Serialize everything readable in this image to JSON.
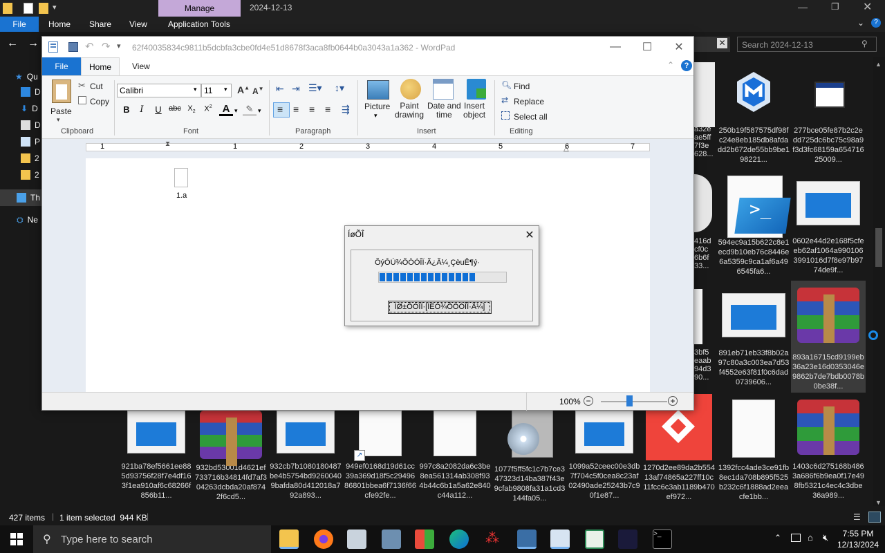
{
  "explorer": {
    "manage_tab": "Manage",
    "window_title": "2024-12-13",
    "ribbon_tabs": {
      "file": "File",
      "home": "Home",
      "share": "Share",
      "view": "View",
      "app_tools": "Application Tools"
    },
    "search_placeholder": "Search 2024-12-13",
    "nav_items": [
      "Qu",
      "D",
      "D",
      "D",
      "P",
      "2",
      "2",
      "Th",
      "Ne"
    ],
    "status": {
      "count": "427 items",
      "selected": "1 item selected  944 KB"
    },
    "files_row1": [
      {
        "name": "250b19f587575df98fc24e8eb185db8afdadd2b672de55bb9be198221...",
        "kind": "malwarebytes"
      },
      {
        "name": "277bce05fe87b2c2edd725dc6bc75c98a9f3d3fc68159a65471625009...",
        "kind": "window"
      }
    ],
    "files_row2": [
      {
        "name": "594ec9a15b622c8e1ecd9b10eb76c8446e6a5359c9ca1af6a496545fa6...",
        "kind": "powershell"
      },
      {
        "name": "0602e44d2e168f5cfeeb62af1064a9901063991016d7f8e97b9774de9f...",
        "kind": "window"
      }
    ],
    "files_row3": [
      {
        "name": "891eb71eb33f8b02a97c80a3c003ea7d53f4552e63f81f0c6dad0739606...",
        "kind": "window"
      },
      {
        "name": "893a16715cd9199eb36a23e16d0353046e9862b7de7bdb0078b0be38f...",
        "kind": "rar"
      }
    ],
    "partial_names": [
      "a32e\nae5ff\n7f3e\n628...",
      "416d\ncf0c\n6b6f\n33...",
      "3bf5\neaab\n94d3\n90..."
    ],
    "files_row4": [
      {
        "name": "921ba78ef5661ee885d93756f28f7e4df163f1ea910af6c68266f856b11...",
        "kind": "window"
      },
      {
        "name": "932bd53001d4621ef733716b34814fd7af304263dcbda20af8742f6cd5...",
        "kind": "rar"
      },
      {
        "name": "932cb7b1080180487be4b5754bd92600409bafda80d412018a792a893...",
        "kind": "window"
      },
      {
        "name": "949ef0168d19d61cc39a369d18f5c2949686801bbea6f7136f66cfe92fe...",
        "kind": "doc"
      },
      {
        "name": "997c8a2082da6c3be8ea561314ab308f934b44c6b1a5a62e840c44a112...",
        "kind": "doc"
      },
      {
        "name": "1077f5ff5fc1c7b7ce347323d14ba387f43e9cfab9808fa31a1cd3144fa05...",
        "kind": "setup"
      },
      {
        "name": "1099a52ceec00e3db7f704c5f0cea8c23af02490ade25243b7c90f1e87...",
        "kind": "window"
      },
      {
        "name": "1270d2ee89da2b55413af74865a227ff10c11fcc6c3ab1189b470ef972...",
        "kind": "anydesk"
      },
      {
        "name": "1392fcc4ade3ce91fb8ec1da708b895f525b232c6f1888ad2eeacfe1bb...",
        "kind": "doc"
      },
      {
        "name": "1403c6d275168b4863a686f6b9ea0f17e498fb5321c4ec4c3dbe36a989...",
        "kind": "rar"
      }
    ]
  },
  "wordpad": {
    "title": "62f40035834c9811b5dcbfa3cbe0fd4e51d8678f3aca8fb0644b0a3043a1a362 - WordPad",
    "tabs": {
      "file": "File",
      "home": "Home",
      "view": "View"
    },
    "clipboard": {
      "paste": "Paste",
      "cut": "Cut",
      "copy": "Copy",
      "label": "Clipboard"
    },
    "font": {
      "name": "Calibri",
      "size": "11",
      "label": "Font"
    },
    "paragraph": {
      "label": "Paragraph"
    },
    "insert": {
      "picture": "Picture",
      "paint_drawing": "Paint\ndrawing",
      "date_time": "Date and\ntime",
      "insert_object": "Insert\nobject",
      "label": "Insert"
    },
    "editing": {
      "find": "Find",
      "replace": "Replace",
      "select_all": "Select all",
      "label": "Editing"
    },
    "ruler_numbers": [
      "1",
      "1",
      "2",
      "3",
      "4",
      "5",
      "6",
      "7"
    ],
    "embedded_file": "1.a",
    "zoom": "100%"
  },
  "dialog": {
    "title": "ÍøÕÎ",
    "message": "ÕýÔÚ¾ÕÖÓÎÏ·Ã¿Ã¼¸ÇèuÊ¶ý·",
    "progress": 0.8,
    "button": "ÍØ±ÕÓÎÏ·[ÍËÓ¾ÕÖÓÎÏ·Ã¼]"
  },
  "taskbar": {
    "search_placeholder": "Type here to search",
    "time": "7:55 PM",
    "date": "12/13/2024"
  }
}
